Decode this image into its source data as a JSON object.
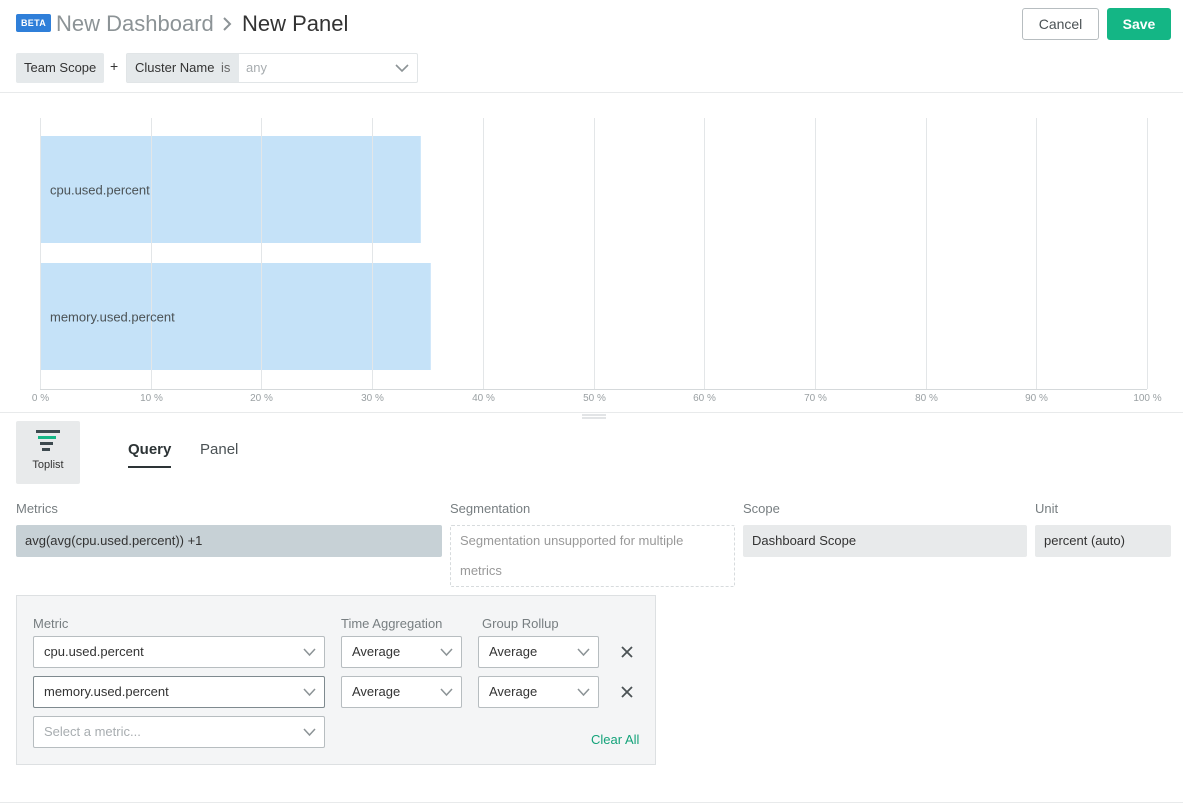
{
  "header": {
    "badge": "BETA",
    "breadcrumb_parent": "New Dashboard",
    "title": "New Panel",
    "cancel_label": "Cancel",
    "save_label": "Save"
  },
  "scope_bar": {
    "team_scope": "Team Scope",
    "plus": "+",
    "filter_field": "Cluster Name",
    "filter_operator": "is",
    "filter_value_placeholder": "any"
  },
  "chart_data": {
    "type": "bar",
    "orientation": "horizontal",
    "categories": [
      "cpu.used.percent",
      "memory.used.percent"
    ],
    "values": [
      34.4,
      35.3
    ],
    "unit": "%",
    "xlim": [
      0,
      100
    ],
    "xticks": [
      "0 %",
      "10 %",
      "20 %",
      "30 %",
      "40 %",
      "50 %",
      "60 %",
      "70 %",
      "80 %",
      "90 %",
      "100 %"
    ],
    "bar_color": "#c5e2f8",
    "grid": true
  },
  "editor": {
    "viz_type_label": "Toplist",
    "tabs": [
      {
        "label": "Query",
        "active": true
      },
      {
        "label": "Panel",
        "active": false
      }
    ],
    "columns": {
      "metrics_label": "Metrics",
      "metrics_value": "avg(avg(cpu.used.percent)) +1",
      "segmentation_label": "Segmentation",
      "segmentation_value": "Segmentation unsupported for multiple metrics",
      "scope_label": "Scope",
      "scope_value": "Dashboard Scope",
      "unit_label": "Unit",
      "unit_value": "percent (auto)"
    },
    "metric_table": {
      "metric_header": "Metric",
      "time_agg_header": "Time Aggregation",
      "group_rollup_header": "Group Rollup",
      "rows": [
        {
          "metric": "cpu.used.percent",
          "time_aggregation": "Average",
          "group_rollup": "Average"
        },
        {
          "metric": "memory.used.percent",
          "time_aggregation": "Average",
          "group_rollup": "Average"
        }
      ],
      "new_metric_placeholder": "Select a metric...",
      "clear_all_label": "Clear All"
    }
  },
  "colors": {
    "accent": "#14b685",
    "badge": "#2f7fd9",
    "bar": "#c5e2f8"
  }
}
